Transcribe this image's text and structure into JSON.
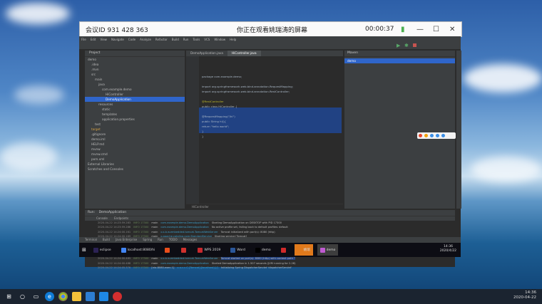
{
  "meeting": {
    "id_label": "会议ID 931 428 363",
    "viewing_label": "你正在观看姚瑞涛的屏幕",
    "timer": "00:00:37"
  },
  "ide": {
    "menu": [
      "File",
      "Edit",
      "View",
      "Navigate",
      "Code",
      "Analyze",
      "Refactor",
      "Build",
      "Run",
      "Tools",
      "VCS",
      "Window",
      "Help"
    ],
    "project_header": "Project",
    "tree": [
      {
        "label": "demo",
        "indent": 0,
        "style": ""
      },
      {
        "label": ".idea",
        "indent": 1,
        "style": ""
      },
      {
        "label": ".mvn",
        "indent": 1,
        "style": ""
      },
      {
        "label": "src",
        "indent": 1,
        "style": ""
      },
      {
        "label": "main",
        "indent": 2,
        "style": ""
      },
      {
        "label": "java",
        "indent": 3,
        "style": ""
      },
      {
        "label": "com.example.demo",
        "indent": 4,
        "style": ""
      },
      {
        "label": "HiController",
        "indent": 5,
        "style": ""
      },
      {
        "label": "DemoApplication",
        "indent": 5,
        "style": "selblue"
      },
      {
        "label": "resources",
        "indent": 3,
        "style": ""
      },
      {
        "label": "static",
        "indent": 4,
        "style": ""
      },
      {
        "label": "templates",
        "indent": 4,
        "style": ""
      },
      {
        "label": "application.properties",
        "indent": 4,
        "style": ""
      },
      {
        "label": "test",
        "indent": 2,
        "style": ""
      },
      {
        "label": "target",
        "indent": 1,
        "style": "orange"
      },
      {
        "label": ".gitignore",
        "indent": 1,
        "style": ""
      },
      {
        "label": "demo.iml",
        "indent": 1,
        "style": ""
      },
      {
        "label": "HELP.md",
        "indent": 1,
        "style": ""
      },
      {
        "label": "mvnw",
        "indent": 1,
        "style": ""
      },
      {
        "label": "mvnw.cmd",
        "indent": 1,
        "style": ""
      },
      {
        "label": "pom.xml",
        "indent": 1,
        "style": ""
      },
      {
        "label": "External Libraries",
        "indent": 0,
        "style": ""
      },
      {
        "label": "Scratches and Consoles",
        "indent": 0,
        "style": ""
      }
    ],
    "tabs": [
      "DemoApplication.java",
      "HiController.java"
    ],
    "code": [
      "package com.example.demo;",
      "",
      "import org.springframework.web.bind.annotation.RequestMapping;",
      "import org.springframework.web.bind.annotation.RestController;",
      "",
      "@RestController",
      "public class HiController {",
      "",
      "    @RequestMapping(\"/hi\")",
      "    public String hi(){",
      "        return \"hello world\";",
      "    }",
      "}"
    ],
    "breadcrumb": "HiController",
    "maven_header": "Maven",
    "maven_item": "demo",
    "run_header": "Run:",
    "run_config": "DemoApplication",
    "run_tabs": [
      "Console",
      "Endpoints"
    ],
    "log": [
      {
        "ts": "2020-04-22 14:23:59.283",
        "lvl": "INFO 17300",
        "thr": "main",
        "cls": "com.example.demo.DemoApplication",
        "msg": "Starting DemoApplication on DESKTOP with PID 17300"
      },
      {
        "ts": "2020-04-22 14:23:59.286",
        "lvl": "INFO 17300",
        "thr": "main",
        "cls": "com.example.demo.DemoApplication",
        "msg": "No active profile set, falling back to default profiles: default"
      },
      {
        "ts": "2020-04-22 14:24:00.161",
        "lvl": "INFO 17300",
        "thr": "main",
        "cls": "o.s.b.w.embedded.tomcat.TomcatWebServer",
        "msg": "Tomcat initialized with port(s): 8080 (http)"
      },
      {
        "ts": "2020-04-22 14:24:00.169",
        "lvl": "INFO 17300",
        "thr": "main",
        "cls": "o.apache.catalina.core.StandardService",
        "msg": "Starting service [Tomcat]"
      },
      {
        "ts": "2020-04-22 14:24:00.170",
        "lvl": "INFO 17300",
        "thr": "main",
        "cls": "org.apache.catalina.core.StandardEngine",
        "msg": "Starting Servlet engine: [Apache Tomcat/9.0.33]"
      },
      {
        "ts": "2020-04-22 14:24:00.241",
        "lvl": "INFO 17300",
        "thr": "main",
        "cls": "o.a.c.c.C.[Tomcat].[localhost].[/]",
        "msg": "Initializing Spring embedded WebApplicationContext"
      },
      {
        "ts": "2020-04-22 14:24:00.241",
        "lvl": "INFO 17300",
        "thr": "main",
        "cls": "o.s.web.context.ContextLoader",
        "msg": "Root WebApplicationContext: initialization completed in 917 ms"
      },
      {
        "ts": "2020-04-22 14:24:00.360",
        "lvl": "INFO 17300",
        "thr": "main",
        "cls": "o.s.s.concurrent.ThreadPoolTaskExecutor",
        "msg": "Initializing ExecutorService 'applicationTaskExecutor'"
      },
      {
        "ts": "2020-04-22 14:24:00.485",
        "lvl": "INFO 17300",
        "thr": "main",
        "cls": "o.s.b.w.embedded.tomcat.TomcatWebServer",
        "msg": "Tomcat started on port(s): 8080 (http) with context path ''",
        "sel": true
      },
      {
        "ts": "2020-04-22 14:24:00.488",
        "lvl": "INFO 17300",
        "thr": "main",
        "cls": "com.example.demo.DemoApplication",
        "msg": "Started DemoApplication in 1.507 seconds (JVM running for 2.28)"
      },
      {
        "ts": "2020-04-22 14:24:05.376",
        "lvl": "INFO 17300",
        "thr": "[nio-8080-exec-1]",
        "cls": "o.a.c.c.C.[Tomcat].[localhost].[/]",
        "msg": "Initializing Spring DispatcherServlet 'dispatcherServlet'"
      }
    ],
    "status_items": [
      "Terminal",
      "Build",
      "Java Enterprise",
      "Spring",
      "Run",
      "TODO",
      "Messages"
    ]
  },
  "inner_taskbar": [
    {
      "label": "eclipse",
      "color": "#2c2255",
      "style": ""
    },
    {
      "label": "localhost:8080/hi",
      "color": "#4285f4",
      "style": ""
    },
    {
      "label": "",
      "color": "#e94e1b",
      "style": ""
    },
    {
      "label": "",
      "color": "#d0312d",
      "style": ""
    },
    {
      "label": "WPS 2019",
      "color": "#c8292e",
      "style": ""
    },
    {
      "label": "Word",
      "color": "#2b579a",
      "style": ""
    },
    {
      "label": "demo",
      "color": "#000000",
      "style": ""
    },
    {
      "label": "",
      "color": "#d12a2a",
      "style": ""
    },
    {
      "label": "姚瑞",
      "color": "#e07a1c",
      "style": "orange"
    },
    {
      "label": "demo",
      "color": "#c05bd2",
      "style": "active"
    }
  ],
  "taskbar": {
    "clock_time": "14:36",
    "clock_date": "2020-04-22",
    "inner_clock_time": "14:36",
    "inner_clock_date": "2020/4/22"
  },
  "colors": {
    "accent": "#2f65ca",
    "ide_bg": "#2b2b2b",
    "panel": "#3c3f41"
  }
}
